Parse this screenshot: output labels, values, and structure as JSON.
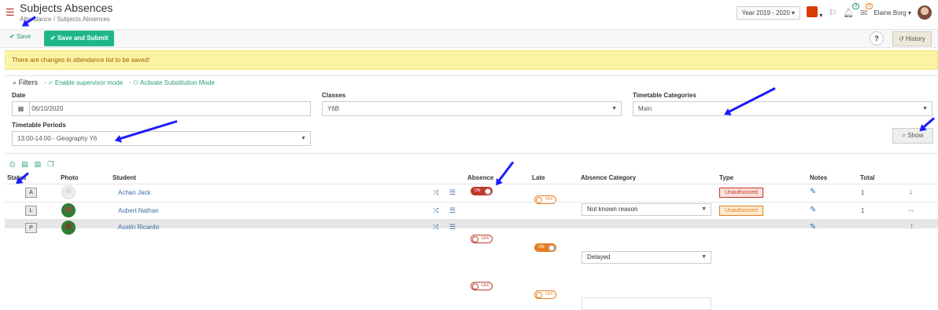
{
  "header": {
    "title": "Subjects Absences",
    "crumb_home": "Attendance",
    "crumb_sep": "/",
    "crumb_current": "Subjects Absences",
    "year": "Year 2019 - 2020",
    "notif_count": "3",
    "mail_count": "0",
    "user": "Elaine Borg"
  },
  "toolbar": {
    "save": "Save",
    "submit": "Save and Submit",
    "help": "?",
    "history": "History"
  },
  "alert": "There are changes in attendance list to be saved!",
  "filters": {
    "title": "Filters",
    "supervisor": "Enable supervisor mode",
    "substitution": "Activate Substitution Mode",
    "date_label": "Date",
    "date_value": "06/10/2020",
    "classes_label": "Classes",
    "classes_value": "Y6B",
    "tt_cat_label": "Timetable Categories",
    "tt_cat_value": "Main",
    "tt_per_label": "Timetable Periods",
    "tt_per_value": "13:00-14:00 - Geography Y6",
    "show": "Show"
  },
  "table": {
    "headers": {
      "status": "Status",
      "photo": "Photo",
      "student": "Student",
      "absence": "Absence",
      "late": "Late",
      "category": "Absence Category",
      "type": "Type",
      "notes": "Notes",
      "total": "Total"
    },
    "rows": [
      {
        "status": "A",
        "name": "Achan Jack",
        "absence": "ON",
        "late": "OFF",
        "category": "Not known reason",
        "type": "Unauthorized",
        "total": "1"
      },
      {
        "status": "L",
        "name": "Aubert Nathan",
        "absence": "OFF",
        "late": "ON",
        "category": "Delayed",
        "type": "Unauthorized",
        "total": "1"
      },
      {
        "status": "P",
        "name": "Austin Ricardo",
        "absence": "OFF",
        "late": "OFF",
        "category": "",
        "type": "",
        "total": ""
      }
    ]
  },
  "colors": {
    "accent": "#1fb78a",
    "alert_bg": "#fdf3a5",
    "danger": "#c0392b"
  }
}
